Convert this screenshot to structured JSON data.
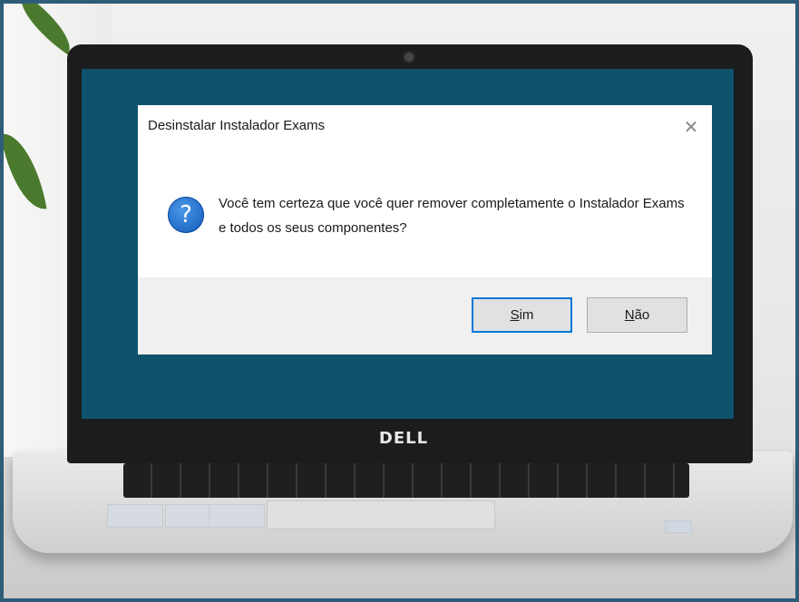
{
  "background": {
    "laptop_brand": "DELL"
  },
  "dialog": {
    "title": "Desinstalar Instalador Exams",
    "close_glyph": "✕",
    "icon": "question-icon",
    "icon_glyph": "?",
    "message": "Você tem certeza que você quer remover completamente o Instalador Exams e todos os seus componentes?",
    "buttons": {
      "yes_accel": "S",
      "yes_rest": "im",
      "no_accel": "N",
      "no_rest": "ão"
    }
  },
  "colors": {
    "screen": "#0e526c",
    "accent_focus": "#0078d7",
    "icon_blue": "#1158b8"
  }
}
